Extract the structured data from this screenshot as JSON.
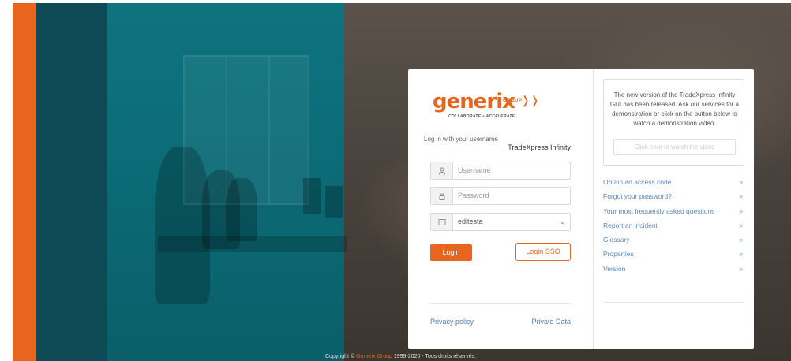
{
  "footer": {
    "prefix": "Copyright © ",
    "brand": "Generix Group",
    "suffix": " 1999-2020 - Tous droits réservés."
  },
  "logo": {
    "word": "generix",
    "group": "GROUP",
    "tagline": "COLLABORATE » ACCELERATE"
  },
  "login": {
    "hint": "Log in with your username",
    "product": "TradeXpress Infinity",
    "username_placeholder": "Username",
    "password_placeholder": "Password",
    "environment_value": "editesta",
    "login_label": "Login",
    "sso_label": "Login SSO"
  },
  "links": {
    "privacy": "Privacy policy",
    "private_data": "Private Data"
  },
  "info": {
    "text": "The new version of the TradeXpress Infinity GUI has been released. Ask our services for a demonstration or click on the button below to watch a demonstration video.",
    "video_button": "Click here to watch the video"
  },
  "menu": {
    "items": [
      {
        "label": "Obtain an access code"
      },
      {
        "label": "Forgot your password?"
      },
      {
        "label": "Your most frequently asked questions"
      },
      {
        "label": "Report an incident"
      },
      {
        "label": "Glossary"
      },
      {
        "label": "Properties"
      },
      {
        "label": "Version"
      }
    ]
  },
  "colors": {
    "accent": "#e8651f",
    "link": "#5a8ac0",
    "teal": "#0b6a75"
  },
  "icons": {
    "username": "user-icon",
    "password": "lock-icon",
    "environment": "window-icon",
    "menu_chevron": "chevron-right-icon"
  }
}
